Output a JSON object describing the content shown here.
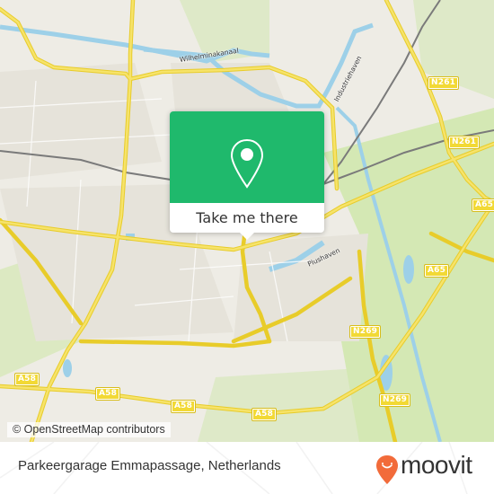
{
  "map": {
    "attribution": "© OpenStreetMap contributors",
    "water_labels": [
      "Wilhelminakanaal",
      "Industriehaven",
      "Plushaven"
    ],
    "road_shields": [
      "N261",
      "N261",
      "A65",
      "A65",
      "N269",
      "N269",
      "A58",
      "A58",
      "A58",
      "A58"
    ],
    "colors": {
      "land": "#eeece5",
      "green": "#d4e8b4",
      "water": "#9dd0e8",
      "road": "#f2d935",
      "rail": "#777777"
    }
  },
  "popup": {
    "icon": "map-pin-icon",
    "cta_label": "Take me there",
    "color": "#1fb96c"
  },
  "footer": {
    "place_name": "Parkeergarage Emmapassage, Netherlands",
    "brand": "moovit",
    "brand_icon": "moovit-logo-icon",
    "brand_color": "#f26b3a"
  }
}
